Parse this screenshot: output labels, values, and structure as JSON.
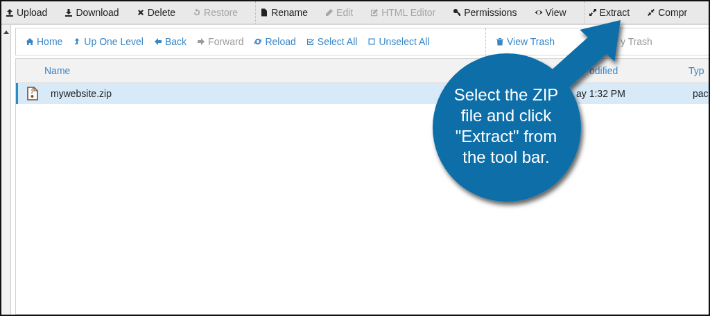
{
  "toolbar": {
    "groups": [
      [
        {
          "label": "Upload",
          "disabled": false
        },
        {
          "label": "Download",
          "disabled": false
        },
        {
          "label": "Delete",
          "disabled": false
        },
        {
          "label": "Restore",
          "disabled": true
        }
      ],
      [
        {
          "label": "Rename",
          "disabled": false
        },
        {
          "label": "Edit",
          "disabled": true
        },
        {
          "label": "HTML Editor",
          "disabled": true
        },
        {
          "label": "Permissions",
          "disabled": false
        },
        {
          "label": "View",
          "disabled": false
        }
      ],
      [
        {
          "label": "Extract",
          "disabled": false
        },
        {
          "label": "Compr",
          "disabled": false
        }
      ]
    ]
  },
  "navbar": {
    "groups": [
      [
        {
          "label": "Home",
          "disabled": false
        },
        {
          "label": "Up One Level",
          "disabled": false
        },
        {
          "label": "Back",
          "disabled": false
        },
        {
          "label": "Forward",
          "disabled": true
        },
        {
          "label": "Reload",
          "disabled": false
        },
        {
          "label": "Select All",
          "disabled": false
        },
        {
          "label": "Unselect All",
          "disabled": false
        }
      ],
      [
        {
          "label": "View Trash",
          "disabled": false
        },
        {
          "label": "y Trash",
          "disabled": true
        }
      ]
    ]
  },
  "table": {
    "columns": [
      "Name",
      "odified",
      "Typ"
    ],
    "rows": [
      {
        "name": "mywebsite.zip",
        "modified": "ay 1:32 PM",
        "type": "pac",
        "selected": true
      }
    ]
  },
  "callout": {
    "text": "Select the ZIP file and click \"Extract\" from the tool bar."
  }
}
